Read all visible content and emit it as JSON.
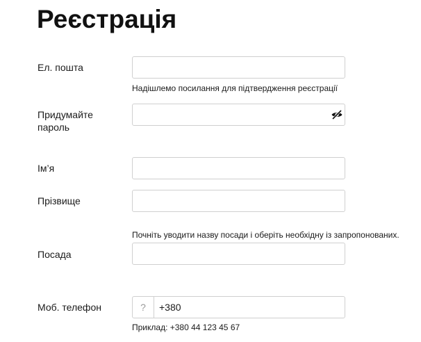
{
  "page": {
    "title": "Реєстрація"
  },
  "form": {
    "email": {
      "label": "Ел. пошта",
      "value": "",
      "hint": "Надішлемо посилання для підтвердження реєстрації"
    },
    "password": {
      "label": "Придумайте пароль",
      "value": "",
      "toggle_icon": "eye-slash-icon"
    },
    "first_name": {
      "label": "Ім’я",
      "value": ""
    },
    "last_name": {
      "label": "Прізвище",
      "value": ""
    },
    "position": {
      "hint": "Почніть уводити назву посади і оберіть необхідну із запропонованих.",
      "label": "Посада",
      "value": ""
    },
    "phone": {
      "label": "Моб. телефон",
      "country_symbol": "?",
      "value": "+380",
      "hint": "Приклад: +380 44 123 45 67"
    }
  },
  "colors": {
    "border": "#cfcfcf",
    "text": "#1a1a1a",
    "muted": "#9a9a9a"
  }
}
